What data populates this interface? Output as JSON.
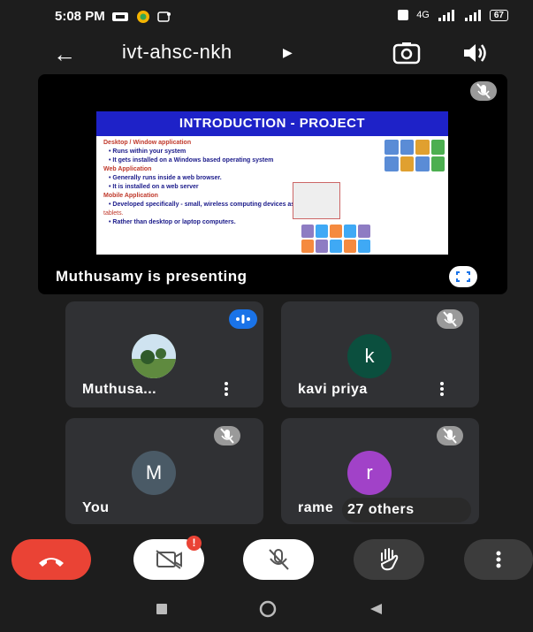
{
  "status_bar": {
    "time": "5:08 PM",
    "network": "4G",
    "battery": "67"
  },
  "top_bar": {
    "title": "ivt-ahsc-nkh",
    "back_icon": "arrow-left-icon",
    "switch_camera_icon": "switch-camera-icon",
    "speaker_icon": "speaker-icon"
  },
  "presentation": {
    "label": "Muthusamy is presenting",
    "slide": {
      "title": "INTRODUCTION - PROJECT",
      "lines": [
        {
          "style": "h",
          "text": "Desktop / Window application"
        },
        {
          "style": "b",
          "text": "• Runs within your system"
        },
        {
          "style": "b",
          "text": "• It gets installed on a Windows based operating system"
        },
        {
          "style": "h",
          "text": "Web Application"
        },
        {
          "style": "b",
          "text": "• Generally runs inside a web browser."
        },
        {
          "style": "b",
          "text": "• It is installed on a web server"
        },
        {
          "style": "h",
          "text": "Mobile Application"
        },
        {
          "style": "b",
          "text": "• Developed specifically - small, wireless computing devices as smartphones"
        },
        {
          "style": "r",
          "text": "  tablets."
        },
        {
          "style": "b",
          "text": "• Rather than desktop or laptop computers."
        }
      ]
    }
  },
  "participants": [
    {
      "name": "Muthusa...",
      "avatar": "photo",
      "speaking": true
    },
    {
      "name": "kavi priya",
      "avatar": "k",
      "muted": true
    },
    {
      "name": "You",
      "avatar": "M",
      "muted": true
    },
    {
      "name": "rame",
      "avatar": "r",
      "muted": true
    }
  ],
  "others_label": "27 others",
  "controls": {
    "end_call_icon": "end-call-icon",
    "camera_off_icon": "camera-off-icon",
    "mic_off_icon": "mic-off-icon",
    "raise_hand_icon": "raise-hand-icon",
    "more_icon": "more-vert-icon"
  },
  "colors": {
    "end_call": "#ea4335",
    "kavi_avatar": "#0b4f3e",
    "you_avatar": "#4a5a66",
    "rame_avatar": "#a142c8",
    "speaking": "#1a73e8"
  }
}
